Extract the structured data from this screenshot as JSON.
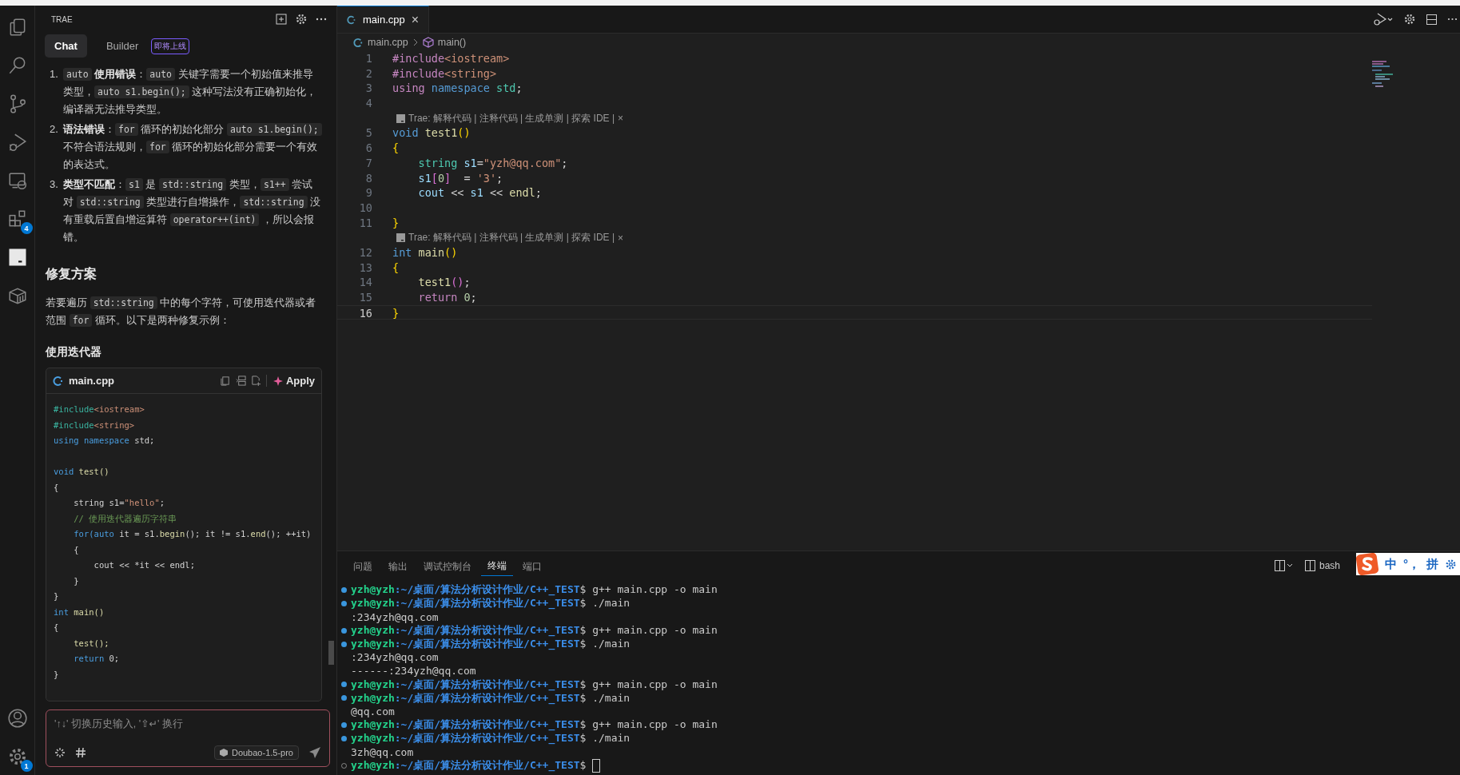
{
  "activity_bar": {
    "items": [
      {
        "kind": "files",
        "selected": false
      },
      {
        "kind": "search",
        "selected": false
      },
      {
        "kind": "source-control",
        "selected": false
      },
      {
        "kind": "run-debug",
        "selected": false
      },
      {
        "kind": "remote",
        "selected": false
      },
      {
        "kind": "extensions",
        "selected": false,
        "badge": "4"
      },
      {
        "kind": "trae",
        "selected": true
      },
      {
        "kind": "box",
        "selected": false
      }
    ],
    "bottom_items": [
      {
        "kind": "account",
        "selected": false
      },
      {
        "kind": "settings",
        "selected": false,
        "badge": "1"
      }
    ]
  },
  "chat_panel": {
    "title": "TRAE",
    "tabs": [
      {
        "label": "Chat",
        "selected": true
      },
      {
        "label": "Builder",
        "selected": false,
        "badge": "即将上线"
      }
    ],
    "list": [
      {
        "number": "1.",
        "segments": [
          {
            "text": "auto",
            "kind": "code"
          },
          {
            "text": "使用错误",
            "kind": "bold"
          },
          {
            "text": "：",
            "kind": "text"
          },
          {
            "text": "auto",
            "kind": "code"
          },
          {
            "text": " 关键字需要一个初始值来推导类型，",
            "kind": "text"
          },
          {
            "text": "auto s1.begin();",
            "kind": "code"
          },
          {
            "text": " 这种写法没有正确初始化，编译器无法推导类型。",
            "kind": "text"
          }
        ]
      },
      {
        "number": "2.",
        "segments": [
          {
            "text": "语法错误",
            "kind": "bold"
          },
          {
            "text": "：",
            "kind": "text"
          },
          {
            "text": "for",
            "kind": "code"
          },
          {
            "text": " 循环的初始化部分 ",
            "kind": "text"
          },
          {
            "text": "auto s1.begin();",
            "kind": "code"
          },
          {
            "text": " 不符合语法规则，",
            "kind": "text"
          },
          {
            "text": "for",
            "kind": "code"
          },
          {
            "text": " 循环的初始化部分需要一个有效的表达式。",
            "kind": "text"
          }
        ]
      },
      {
        "number": "3.",
        "segments": [
          {
            "text": "类型不匹配",
            "kind": "bold"
          },
          {
            "text": "：",
            "kind": "text"
          },
          {
            "text": "s1",
            "kind": "code"
          },
          {
            "text": " 是 ",
            "kind": "text"
          },
          {
            "text": "std::string",
            "kind": "code"
          },
          {
            "text": " 类型，",
            "kind": "text"
          },
          {
            "text": "s1++",
            "kind": "code"
          },
          {
            "text": " 尝试对 ",
            "kind": "text"
          },
          {
            "text": "std::string",
            "kind": "code"
          },
          {
            "text": " 类型进行自增操作，",
            "kind": "text"
          },
          {
            "text": "std::string",
            "kind": "code"
          },
          {
            "text": " 没有重载后置自增运算符 ",
            "kind": "text"
          },
          {
            "text": "operator++(int)",
            "kind": "code"
          },
          {
            "text": "，所以会报错。",
            "kind": "text"
          }
        ]
      }
    ],
    "heading": "修复方案",
    "paragraph": [
      {
        "text": "若要遍历 ",
        "kind": "text"
      },
      {
        "text": "std::string",
        "kind": "code"
      },
      {
        "text": " 中的每个字符，可使用迭代器或者范围 ",
        "kind": "text"
      },
      {
        "text": "for",
        "kind": "code"
      },
      {
        "text": " 循环。以下是两种修复示例：",
        "kind": "text"
      }
    ],
    "subheading": "使用迭代器",
    "code_block": {
      "filename": "main.cpp",
      "apply": "Apply",
      "lines": [
        {
          "kind": "code",
          "tokens": [
            {
              "text": "#include",
              "kind": "pp"
            },
            {
              "text": "<iostream>",
              "kind": "str"
            }
          ]
        },
        {
          "kind": "code",
          "tokens": [
            {
              "text": "#include",
              "kind": "pp"
            },
            {
              "text": "<string>",
              "kind": "str"
            }
          ]
        },
        {
          "kind": "code",
          "tokens": [
            {
              "text": "using namespace",
              "kind": "kw"
            },
            {
              "text": " std;",
              "kind": "plain"
            }
          ]
        },
        {
          "kind": "blank"
        },
        {
          "kind": "code",
          "tokens": [
            {
              "text": "void",
              "kind": "kw"
            },
            {
              "text": " test()",
              "kind": "fn"
            }
          ]
        },
        {
          "kind": "code",
          "tokens": [
            {
              "text": "{",
              "kind": "plain"
            }
          ]
        },
        {
          "kind": "code",
          "tokens": [
            {
              "text": "    string s1=",
              "kind": "plain"
            },
            {
              "text": "\"hello\"",
              "kind": "str"
            },
            {
              "text": ";",
              "kind": "plain"
            }
          ]
        },
        {
          "kind": "code",
          "tokens": [
            {
              "text": "    // 使用迭代器遍历字符串",
              "kind": "cm"
            }
          ]
        },
        {
          "kind": "code",
          "tokens": [
            {
              "text": "    for(auto",
              "kind": "kw"
            },
            {
              "text": " it = s1.",
              "kind": "plain"
            },
            {
              "text": "begin",
              "kind": "fn"
            },
            {
              "text": "(); it != s1.",
              "kind": "plain"
            },
            {
              "text": "end",
              "kind": "fn"
            },
            {
              "text": "(); ++it)",
              "kind": "plain"
            }
          ]
        },
        {
          "kind": "code",
          "tokens": [
            {
              "text": "    {",
              "kind": "plain"
            }
          ]
        },
        {
          "kind": "code",
          "tokens": [
            {
              "text": "        cout << *it << endl;",
              "kind": "plain"
            }
          ]
        },
        {
          "kind": "code",
          "tokens": [
            {
              "text": "    }",
              "kind": "plain"
            }
          ]
        },
        {
          "kind": "code",
          "tokens": [
            {
              "text": "}",
              "kind": "plain"
            }
          ]
        },
        {
          "kind": "code",
          "tokens": [
            {
              "text": "int",
              "kind": "kw"
            },
            {
              "text": " main()",
              "kind": "fn"
            }
          ]
        },
        {
          "kind": "code",
          "tokens": [
            {
              "text": "{",
              "kind": "plain"
            }
          ]
        },
        {
          "kind": "code",
          "tokens": [
            {
              "text": "    test();",
              "kind": "fn"
            }
          ]
        },
        {
          "kind": "code",
          "tokens": [
            {
              "text": "    return",
              "kind": "kw"
            },
            {
              "text": " 0;",
              "kind": "plain"
            }
          ]
        },
        {
          "kind": "code",
          "tokens": [
            {
              "text": "}",
              "kind": "plain"
            }
          ]
        }
      ]
    },
    "input": {
      "placeholder": "'↑↓' 切换历史输入, '⇧↵' 换行",
      "model": "Doubao-1.5-pro"
    }
  },
  "editor": {
    "tabs": [
      {
        "label": "main.cpp",
        "selected": true,
        "close": "×"
      }
    ],
    "breadcrumb": [
      {
        "text": "main.cpp",
        "kind": "file"
      },
      {
        "text": "main()",
        "kind": "symbol"
      }
    ],
    "lines": [
      {
        "kind": "code",
        "number": "1",
        "current": false,
        "tokens": [
          {
            "text": "#include",
            "kind": "ctl"
          },
          {
            "text": "<iostream>",
            "kind": "str"
          }
        ]
      },
      {
        "kind": "code",
        "number": "2",
        "current": false,
        "tokens": [
          {
            "text": "#include",
            "kind": "ctl"
          },
          {
            "text": "<string>",
            "kind": "str"
          }
        ]
      },
      {
        "kind": "code",
        "number": "3",
        "current": false,
        "tokens": [
          {
            "text": "using",
            "kind": "ctl"
          },
          {
            "text": " namespace",
            "kind": "kw"
          },
          {
            "text": " std",
            "kind": "type"
          },
          {
            "text": ";",
            "kind": "plain"
          }
        ]
      },
      {
        "kind": "code",
        "number": "4",
        "current": false
      },
      {
        "kind": "codelens",
        "text": "Trae: 解释代码 | 注释代码 | 生成单测 | 探索 IDE |",
        "close": "×"
      },
      {
        "kind": "code",
        "number": "5",
        "current": false,
        "tokens": [
          {
            "text": "void",
            "kind": "kw"
          },
          {
            "text": " test1",
            "kind": "fn"
          },
          {
            "text": "()",
            "kind": "b1"
          }
        ]
      },
      {
        "kind": "code",
        "number": "6",
        "current": false,
        "tokens": [
          {
            "text": "{",
            "kind": "b1"
          }
        ]
      },
      {
        "kind": "code",
        "number": "7",
        "current": false,
        "tokens": [
          {
            "text": "    string",
            "kind": "type"
          },
          {
            "text": " s1",
            "kind": "var"
          },
          {
            "text": "=",
            "kind": "plain"
          },
          {
            "text": "\"yzh@qq.com\"",
            "kind": "str"
          },
          {
            "text": ";",
            "kind": "plain"
          }
        ]
      },
      {
        "kind": "code",
        "number": "8",
        "current": false,
        "tokens": [
          {
            "text": "    s1",
            "kind": "var"
          },
          {
            "text": "[",
            "kind": "b2"
          },
          {
            "text": "0",
            "kind": "num"
          },
          {
            "text": "]",
            "kind": "b2"
          },
          {
            "text": "  = ",
            "kind": "plain"
          },
          {
            "text": "'3'",
            "kind": "str"
          },
          {
            "text": ";",
            "kind": "plain"
          }
        ]
      },
      {
        "kind": "code",
        "number": "9",
        "current": false,
        "tokens": [
          {
            "text": "    cout",
            "kind": "var"
          },
          {
            "text": " << ",
            "kind": "plain"
          },
          {
            "text": "s1",
            "kind": "var"
          },
          {
            "text": " << ",
            "kind": "plain"
          },
          {
            "text": "endl",
            "kind": "fn"
          },
          {
            "text": ";",
            "kind": "plain"
          }
        ]
      },
      {
        "kind": "code",
        "number": "10",
        "current": false
      },
      {
        "kind": "code",
        "number": "11",
        "current": false,
        "tokens": [
          {
            "text": "}",
            "kind": "b1"
          }
        ]
      },
      {
        "kind": "codelens",
        "text": "Trae: 解释代码 | 注释代码 | 生成单测 | 探索 IDE |",
        "close": "×"
      },
      {
        "kind": "code",
        "number": "12",
        "current": false,
        "tokens": [
          {
            "text": "int",
            "kind": "kw"
          },
          {
            "text": " main",
            "kind": "fn"
          },
          {
            "text": "()",
            "kind": "b1"
          }
        ]
      },
      {
        "kind": "code",
        "number": "13",
        "current": false,
        "tokens": [
          {
            "text": "{",
            "kind": "b1"
          }
        ]
      },
      {
        "kind": "code",
        "number": "14",
        "current": false,
        "tokens": [
          {
            "text": "    test1",
            "kind": "fn"
          },
          {
            "text": "()",
            "kind": "b2"
          },
          {
            "text": ";",
            "kind": "plain"
          }
        ]
      },
      {
        "kind": "code",
        "number": "15",
        "current": false,
        "tokens": [
          {
            "text": "    return",
            "kind": "ctl"
          },
          {
            "text": " 0",
            "kind": "num"
          },
          {
            "text": ";",
            "kind": "plain"
          }
        ]
      },
      {
        "kind": "code",
        "number": "16",
        "current": true,
        "tokens": [
          {
            "text": "}",
            "kind": "b1"
          }
        ]
      }
    ]
  },
  "terminal": {
    "tabs": [
      {
        "label": "问题",
        "selected": false
      },
      {
        "label": "输出",
        "selected": false
      },
      {
        "label": "调试控制台",
        "selected": false
      },
      {
        "label": "终端",
        "selected": true
      },
      {
        "label": "端口",
        "selected": false
      }
    ],
    "shell": "bash",
    "lines": [
      {
        "kind": "prompt",
        "finished": true,
        "user": "yzh@yzh",
        "path": ":~/桌面/算法分析设计作业/C++_TEST",
        "command": "$ g++ main.cpp -o main"
      },
      {
        "kind": "prompt",
        "finished": true,
        "user": "yzh@yzh",
        "path": ":~/桌面/算法分析设计作业/C++_TEST",
        "command": "$ ./main"
      },
      {
        "kind": "output",
        "text": ":234yzh@qq.com"
      },
      {
        "kind": "prompt",
        "finished": true,
        "user": "yzh@yzh",
        "path": ":~/桌面/算法分析设计作业/C++_TEST",
        "command": "$ g++ main.cpp -o main"
      },
      {
        "kind": "prompt",
        "finished": true,
        "user": "yzh@yzh",
        "path": ":~/桌面/算法分析设计作业/C++_TEST",
        "command": "$ ./main"
      },
      {
        "kind": "output",
        "text": ":234yzh@qq.com"
      },
      {
        "kind": "output",
        "text": "------:234yzh@qq.com"
      },
      {
        "kind": "prompt",
        "finished": true,
        "user": "yzh@yzh",
        "path": ":~/桌面/算法分析设计作业/C++_TEST",
        "command": "$ g++ main.cpp -o main"
      },
      {
        "kind": "prompt",
        "finished": true,
        "user": "yzh@yzh",
        "path": ":~/桌面/算法分析设计作业/C++_TEST",
        "command": "$ ./main"
      },
      {
        "kind": "output",
        "text": "@qq.com"
      },
      {
        "kind": "prompt",
        "finished": true,
        "user": "yzh@yzh",
        "path": ":~/桌面/算法分析设计作业/C++_TEST",
        "command": "$ g++ main.cpp -o main"
      },
      {
        "kind": "prompt",
        "finished": true,
        "user": "yzh@yzh",
        "path": ":~/桌面/算法分析设计作业/C++_TEST",
        "command": "$ ./main"
      },
      {
        "kind": "output",
        "text": "3zh@qq.com"
      },
      {
        "kind": "prompt",
        "finished": false,
        "user": "yzh@yzh",
        "path": ":~/桌面/算法分析设计作业/C++_TEST",
        "command": "$"
      }
    ]
  },
  "ime_bar": {
    "items": [
      "中",
      "°，",
      "拼"
    ]
  }
}
